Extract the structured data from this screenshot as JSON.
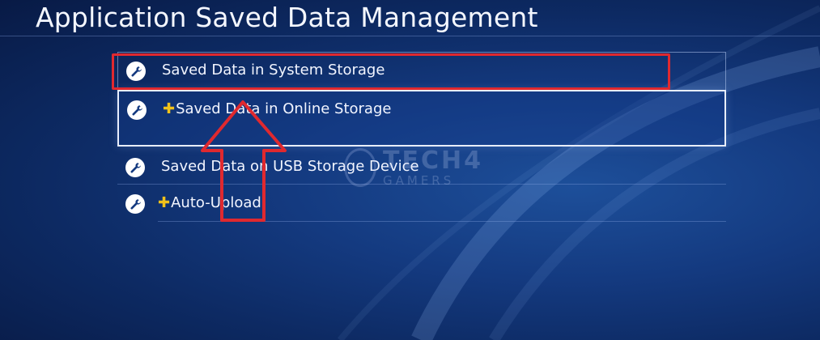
{
  "page": {
    "title": "Application Saved Data Management"
  },
  "menu": {
    "items": [
      {
        "label": "Saved Data in System Storage",
        "plus": false,
        "icon": "wrench-icon"
      },
      {
        "label": "Saved Data in Online Storage",
        "plus": true,
        "icon": "wrench-icon"
      },
      {
        "label": "Saved Data on USB Storage Device",
        "plus": false,
        "icon": "wrench-icon"
      },
      {
        "label": "Auto-Upload",
        "plus": true,
        "icon": "wrench-icon"
      }
    ],
    "plus_glyph": "✚"
  },
  "annotation": {
    "highlight_color": "#e0292f",
    "arrow_color": "#e0292f"
  },
  "watermark": {
    "top": "TECH4",
    "bottom": "GAMERS"
  },
  "colors": {
    "background": "#143a80",
    "plus": "#f2c21a"
  }
}
